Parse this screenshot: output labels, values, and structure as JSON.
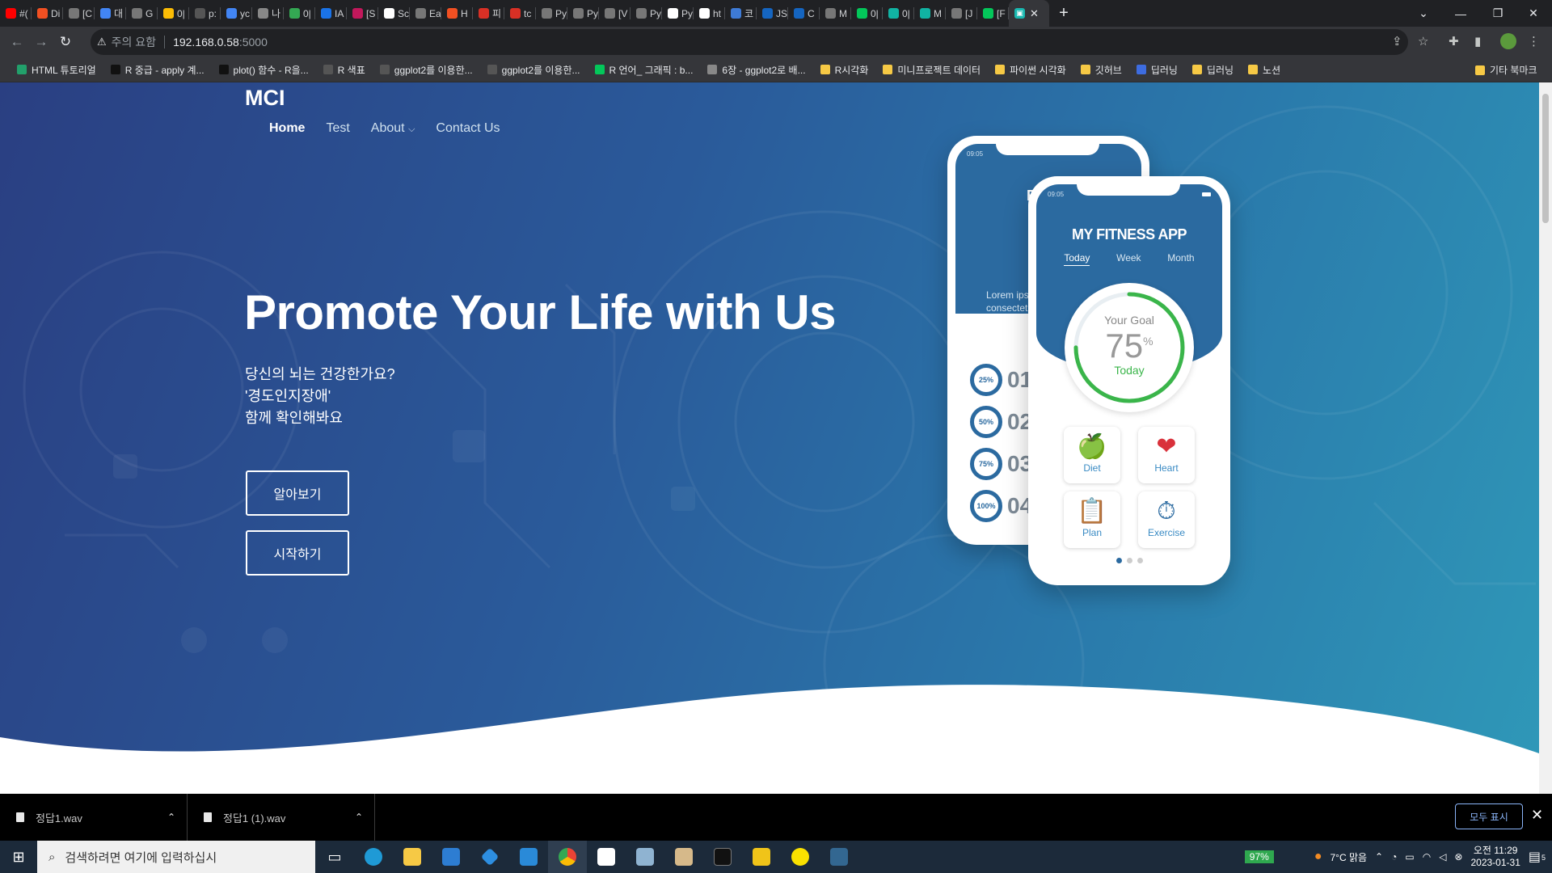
{
  "browser": {
    "tabs": [
      {
        "label": "#(",
        "color": "#ff0000"
      },
      {
        "label": "Di",
        "color": "#f25022"
      },
      {
        "label": "[C",
        "color": "#777777"
      },
      {
        "label": "대",
        "color": "#4285f4"
      },
      {
        "label": "G",
        "color": "#777777"
      },
      {
        "label": "0|",
        "color": "#fbbc05"
      },
      {
        "label": "p:",
        "color": "#555555"
      },
      {
        "label": "yc",
        "color": "#4285f4"
      },
      {
        "label": "나",
        "color": "#888888"
      },
      {
        "label": "0|",
        "color": "#34a853"
      },
      {
        "label": "IA",
        "color": "#1a73e8"
      },
      {
        "label": "[S",
        "color": "#c2185b"
      },
      {
        "label": "Sc",
        "color": "#ffffff"
      },
      {
        "label": "Ea",
        "color": "#777777"
      },
      {
        "label": "H",
        "color": "#f25022"
      },
      {
        "label": "피",
        "color": "#d93025"
      },
      {
        "label": "tc",
        "color": "#d93025"
      },
      {
        "label": "Py",
        "color": "#777777"
      },
      {
        "label": "Py",
        "color": "#777777"
      },
      {
        "label": "[V",
        "color": "#777777"
      },
      {
        "label": "Py",
        "color": "#777777"
      },
      {
        "label": "Py",
        "color": "#ffffff"
      },
      {
        "label": "ht",
        "color": "#ffffff"
      },
      {
        "label": "코",
        "color": "#3e7bd6"
      },
      {
        "label": "JS",
        "color": "#1565c0"
      },
      {
        "label": "C",
        "color": "#1565c0"
      },
      {
        "label": "M",
        "color": "#777777"
      },
      {
        "label": "0|",
        "color": "#03c75a"
      },
      {
        "label": "0|",
        "color": "#11b3a3"
      },
      {
        "label": "M",
        "color": "#11b3a3"
      },
      {
        "label": "[J",
        "color": "#777777"
      },
      {
        "label": "[F",
        "color": "#03c75a"
      }
    ],
    "active_tab_icon_color": "#19b8b0",
    "url_warning": "주의 요함",
    "url_host": "192.168.0.58",
    "url_port": ":5000",
    "bookmarks": [
      {
        "label": "HTML 튜토리얼",
        "color": "#22a06b"
      },
      {
        "label": "R 중급 - apply 계...",
        "color": "#111111"
      },
      {
        "label": "plot() 함수 - R을...",
        "color": "#111111"
      },
      {
        "label": "R 색표",
        "color": "#555555"
      },
      {
        "label": "ggplot2를 이용한...",
        "color": "#555555"
      },
      {
        "label": "ggplot2를 이용한...",
        "color": "#555555"
      },
      {
        "label": "R 언어_ 그래픽 : b...",
        "color": "#03c75a"
      },
      {
        "label": "6장 - ggplot2로 배...",
        "color": "#888888"
      },
      {
        "label": "R시각화",
        "color": "#f6c945"
      },
      {
        "label": "미니프로젝트 데이터",
        "color": "#f6c945"
      },
      {
        "label": "파이썬 시각화",
        "color": "#f6c945"
      },
      {
        "label": "깃허브",
        "color": "#f6c945"
      },
      {
        "label": "딥러닝",
        "color": "#3d6ce0"
      },
      {
        "label": "딥러닝",
        "color": "#f6c945"
      },
      {
        "label": "노션",
        "color": "#f6c945"
      }
    ],
    "other_bookmarks": "기타 북마크"
  },
  "site": {
    "logo": "MCI",
    "nav": {
      "home": "Home",
      "test": "Test",
      "about": "About",
      "contact": "Contact Us"
    },
    "heading": "Promote Your Life with Us",
    "sub_line1": "당신의 뇌는 건강한가요?",
    "sub_line2": "'경도인지장애'",
    "sub_line3": "함께 확인해봐요",
    "btn_learn": "알아보기",
    "btn_start": "시작하기"
  },
  "phone_front": {
    "time": "09:05",
    "title": "MY FITNESS APP",
    "tabs": [
      "Today",
      "Week",
      "Month"
    ],
    "goal_label": "Your Goal",
    "goal_value": "75",
    "goal_unit": "%",
    "goal_sub": "Today",
    "goal_progress": 0.75,
    "tiles": [
      {
        "label": "Diet",
        "icon": "🍏"
      },
      {
        "label": "Heart",
        "icon": "❤"
      },
      {
        "label": "Plan",
        "icon": "📋"
      },
      {
        "label": "Exercise",
        "icon": "⏱"
      }
    ]
  },
  "phone_back": {
    "time": "09:05",
    "title_fragment": "EX",
    "lorem1": "Lorem ipsu",
    "lorem2": "consectetu",
    "items": [
      {
        "pct": "25%",
        "num": "01"
      },
      {
        "pct": "50%",
        "num": "02"
      },
      {
        "pct": "75%",
        "num": "03"
      },
      {
        "pct": "100%",
        "num": "04"
      }
    ]
  },
  "downloads": [
    {
      "name": "정답1.wav"
    },
    {
      "name": "정답1 (1).wav"
    }
  ],
  "downloads_show_all": "모두 표시",
  "taskbar": {
    "search_placeholder": "검색하려면 여기에 입력하십시",
    "battery": "97%",
    "weather": "7°C  맑음",
    "time": "오전 11:29",
    "date": "2023-01-31",
    "notifications": "5"
  }
}
